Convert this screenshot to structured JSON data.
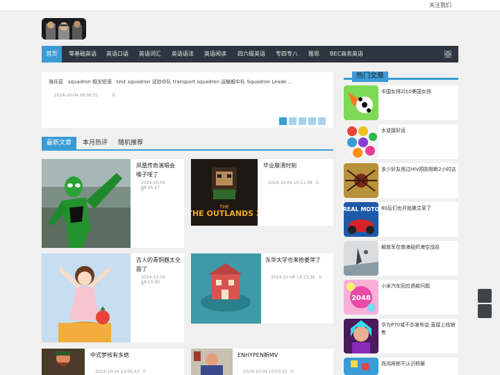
{
  "topbar": {
    "follow": "关注我们"
  },
  "nav": {
    "items": [
      "首页",
      "零基础英语",
      "英语口语",
      "英语词汇",
      "英语语法",
      "英语阅读",
      "四六级英语",
      "专四专八",
      "雅思",
      "BEC商务英语"
    ],
    "menu_icon": "grid-icon"
  },
  "slider": {
    "text": "骑兵营　squadron 相关短语　test squadron 试验中队 transport squadron 运输舰中队 Squadron Leade ...",
    "date": "2024-10-04 09:06:51",
    "count": "0"
  },
  "tabs": [
    "最新文章",
    "本月热评",
    "随机推荐"
  ],
  "articles": [
    {
      "title": "凤凰传奇演唱会 嗓子哑了",
      "date": "2024-10-04 08:06:27",
      "count": "0"
    },
    {
      "title": "毕业崩溃时刻",
      "date": "2024-10-04 10:11:08",
      "count": "0",
      "thumb_text": "THE OUTLANDS 2"
    },
    {
      "title": "古人的青铜器太全面了",
      "date": "2024-10-04 16:10:00",
      "count": "0"
    },
    {
      "title": "东华大学也来抢姜萍了",
      "date": "2024-10-04 13:13:36",
      "count": "0"
    },
    {
      "title": "中式梦核有多绝",
      "date": "2024-10-04 13:00:43",
      "count": "0"
    },
    {
      "title": "ENHYPEN新MV",
      "date": "2024-10-04 10:03:15",
      "count": "0"
    }
  ],
  "sidebar": {
    "title": "热门文章",
    "items": [
      {
        "title": "中国女排2比0美国女排"
      },
      {
        "title": "水逆接好运"
      },
      {
        "title": "多少好友用过HIV预防阻断2小时达"
      },
      {
        "title": "80后们也开始搓艾草了",
        "thumb_text": "REAL MOTO"
      },
      {
        "title": "解放军在南海组织海空战巡"
      },
      {
        "title": "小米汽车回应退款问题",
        "thumb_text": "2048"
      },
      {
        "title": "华为P70或不办发布会 直接上线销售"
      },
      {
        "title": "而鸿将称不认识杨幂"
      }
    ]
  },
  "colors": {
    "accent": "#3a9bd5",
    "nav_bg": "#2d3640"
  }
}
